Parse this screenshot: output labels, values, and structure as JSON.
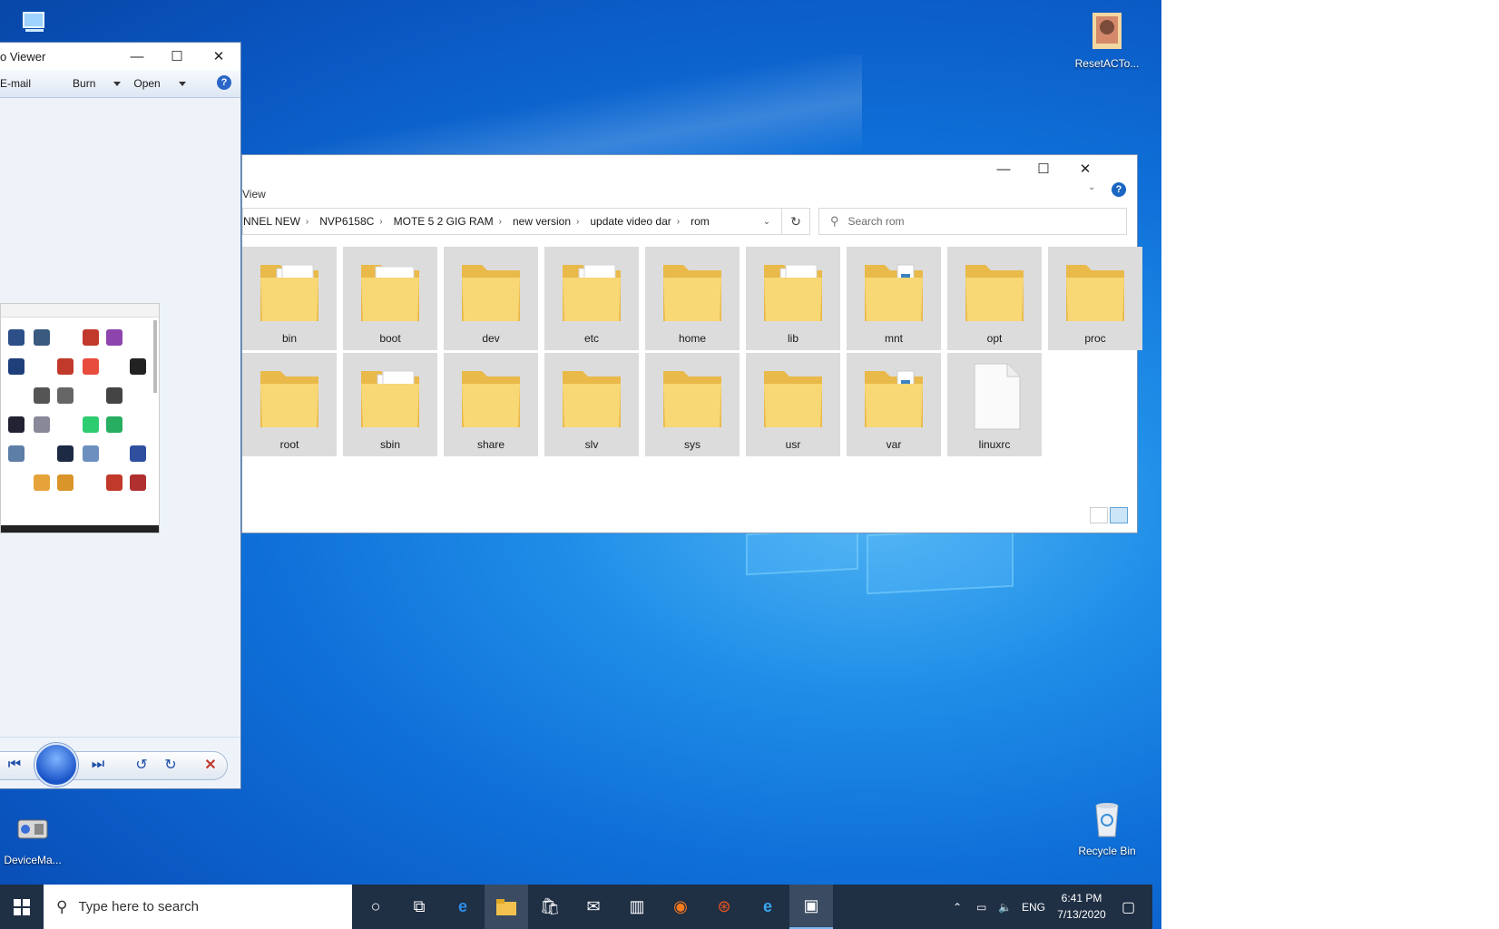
{
  "desktop": {
    "icons": [
      {
        "label": ""
      },
      {
        "label": "ResetACTo..."
      },
      {
        "label": "DeviceMa..."
      },
      {
        "label": "Recycle Bin"
      }
    ]
  },
  "photo_viewer": {
    "title": "o Viewer",
    "menu": {
      "email": "E-mail",
      "burn": "Burn",
      "open": "Open",
      "help": "?"
    }
  },
  "explorer": {
    "ribbon_tab": "View",
    "breadcrumbs": [
      "NNEL NEW",
      "NVP6158C",
      "MOTE 5 2 GIG RAM",
      "new version",
      "update video dar",
      "rom"
    ],
    "search_placeholder": "Search rom",
    "items": [
      {
        "name": "bin",
        "type": "folder-docs"
      },
      {
        "name": "boot",
        "type": "folder-file"
      },
      {
        "name": "dev",
        "type": "folder"
      },
      {
        "name": "etc",
        "type": "folder-docs"
      },
      {
        "name": "home",
        "type": "folder"
      },
      {
        "name": "lib",
        "type": "folder-docs"
      },
      {
        "name": "mnt",
        "type": "folder-striped"
      },
      {
        "name": "opt",
        "type": "folder"
      },
      {
        "name": "proc",
        "type": "folder"
      },
      {
        "name": "root",
        "type": "folder"
      },
      {
        "name": "sbin",
        "type": "folder-docs"
      },
      {
        "name": "share",
        "type": "folder"
      },
      {
        "name": "slv",
        "type": "folder"
      },
      {
        "name": "sys",
        "type": "folder"
      },
      {
        "name": "usr",
        "type": "folder"
      },
      {
        "name": "var",
        "type": "folder-striped"
      },
      {
        "name": "linuxrc",
        "type": "file"
      }
    ]
  },
  "taskbar": {
    "search_placeholder": "Type here to search",
    "language": "ENG",
    "time": "6:41 PM",
    "date": "7/13/2020"
  }
}
